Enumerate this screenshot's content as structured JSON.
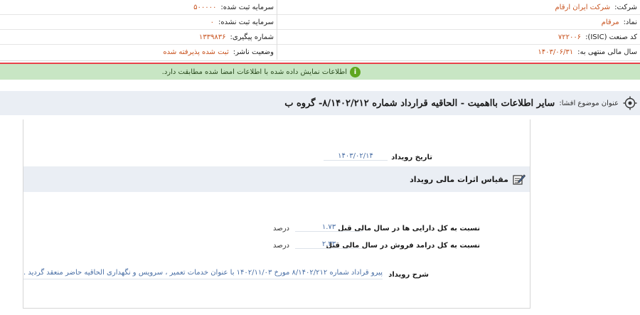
{
  "company_info": {
    "rows": [
      {
        "right_label": "شرکت:",
        "right_value": "شرکت ایران ارقام",
        "left_label": "سرمایه ثبت شده:",
        "left_value": "۵۰۰۰۰۰"
      },
      {
        "right_label": "نماد:",
        "right_value": "مرقام",
        "left_label": "سرمایه ثبت نشده:",
        "left_value": "۰"
      },
      {
        "right_label": "کد صنعت (ISIC):",
        "right_value": "۷۲۲۰۰۶",
        "left_label": "شماره پیگیری:",
        "left_value": "۱۳۳۹۸۳۶"
      },
      {
        "right_label": "سال مالی منتهی به:",
        "right_value": "۱۴۰۳/۰۶/۳۱",
        "left_label": "وضعیت ناشر:",
        "left_value": "ثبت شده پذیرفته شده"
      }
    ]
  },
  "message": {
    "icon": "info-icon",
    "text": "اطلاعات نمایش داده شده با اطلاعات امضا شده مطابقت دارد."
  },
  "subject": {
    "label": "عنوان موضوع افشا:",
    "title": "سایر اطلاعات بااهمیت - الحاقیه قرارداد شماره ۸/۱۴۰۲/۲۱۲- گروه ب"
  },
  "event": {
    "date_label": "تاریخ رویداد",
    "date_value": "۱۴۰۳/۰۲/۱۴"
  },
  "section": {
    "title": "مقیاس اثرات مالی رویداد"
  },
  "metrics": [
    {
      "label": "نسبت به کل دارایی ها در سال مالی قبل",
      "value": "۱.۷۳",
      "unit": "درصد"
    },
    {
      "label": "نسبت به کل درامد فروش در سال مالی قبل",
      "value": "۲.۳۳",
      "unit": "درصد"
    }
  ],
  "description": {
    "label": "شرح رویداد",
    "value": "پیرو قراداد شماره ۸/۱۴۰۲/۲۱۲ مورخ ۱۴۰۲/۱۱/۰۳ با عنوان خدمات تعمیر ، سرویس و نگهداری الحاقیه حاضر منعقد گردید ."
  },
  "colors": {
    "accent_value": "#c8531f",
    "link_value": "#4a6fa5",
    "success_bg": "#c8e6c4",
    "success_icon": "#5fa71f",
    "alert_border": "#e8434a",
    "header_bg": "#eaeef4"
  }
}
